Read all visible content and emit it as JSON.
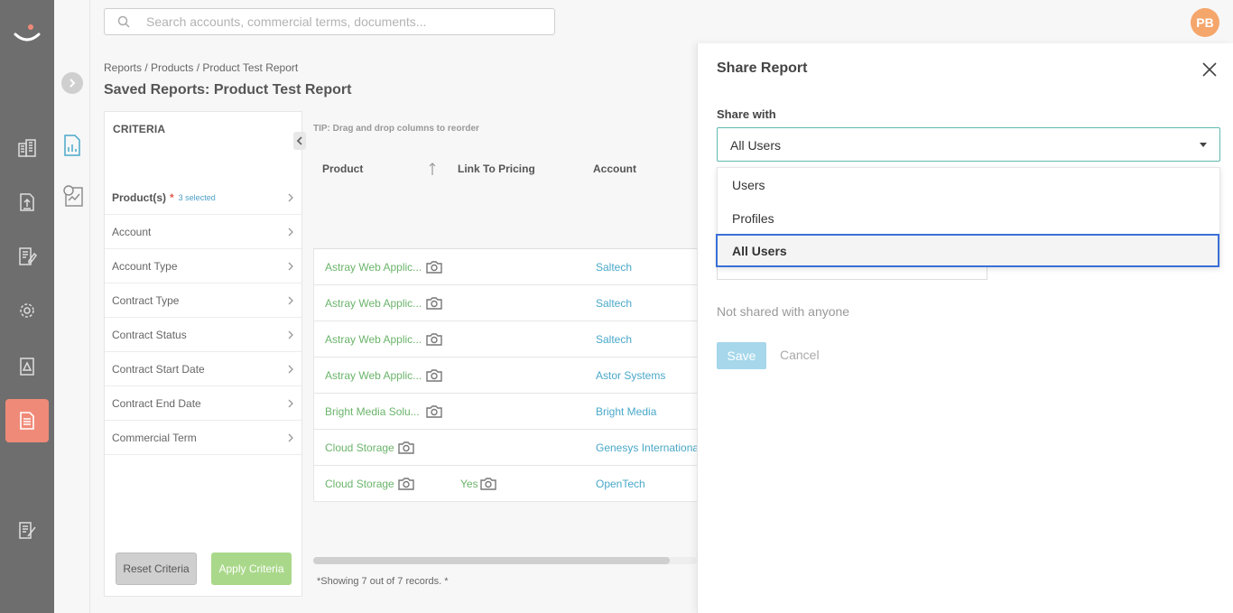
{
  "search": {
    "placeholder": "Search accounts, commercial terms, documents..."
  },
  "user": {
    "initials": "PB"
  },
  "breadcrumb": "Reports / Products / Product Test Report",
  "page_title": "Saved Reports: Product Test Report",
  "criteria": {
    "heading": "CRITERIA",
    "items": [
      {
        "label": "Product(s)",
        "required": "*",
        "selected": "3 selected"
      },
      {
        "label": "Account"
      },
      {
        "label": "Account Type"
      },
      {
        "label": "Contract Type"
      },
      {
        "label": "Contract Status"
      },
      {
        "label": "Contract Start Date"
      },
      {
        "label": "Contract End Date"
      },
      {
        "label": "Commercial Term"
      }
    ],
    "reset_label": "Reset Criteria",
    "apply_label": "Apply Criteria"
  },
  "report": {
    "tip": "TIP: Drag and drop columns to reorder",
    "columns": [
      "Product",
      "Link To Pricing",
      "Account"
    ],
    "rows": [
      {
        "product": "Astray Web Applic...",
        "link": "",
        "account": "Saltech"
      },
      {
        "product": "Astray Web Applic...",
        "link": "",
        "account": "Saltech"
      },
      {
        "product": "Astray Web Applic...",
        "link": "",
        "account": "Saltech"
      },
      {
        "product": "Astray Web Applic...",
        "link": "",
        "account": "Astor Systems"
      },
      {
        "product": "Bright Media Solu...",
        "link": "",
        "account": "Bright Media"
      },
      {
        "product": "Cloud Storage",
        "link": "",
        "account": "Genesys Internationa"
      },
      {
        "product": "Cloud Storage",
        "link": "Yes",
        "account": "OpenTech"
      }
    ],
    "showing": "*Showing 7 out of 7 records. *"
  },
  "share_panel": {
    "title": "Share Report",
    "share_with_label": "Share with",
    "selected_value": "All Users",
    "options": [
      "Users",
      "Profiles",
      "All Users"
    ],
    "not_shared": "Not shared with anyone",
    "save_label": "Save",
    "cancel_label": "Cancel"
  },
  "colors": {
    "rail": "#6e6e6e",
    "active_nav": "#f08a78",
    "product_link": "#6bb46b",
    "account_link": "#4aa8c9",
    "avatar": "#f5a66b"
  }
}
